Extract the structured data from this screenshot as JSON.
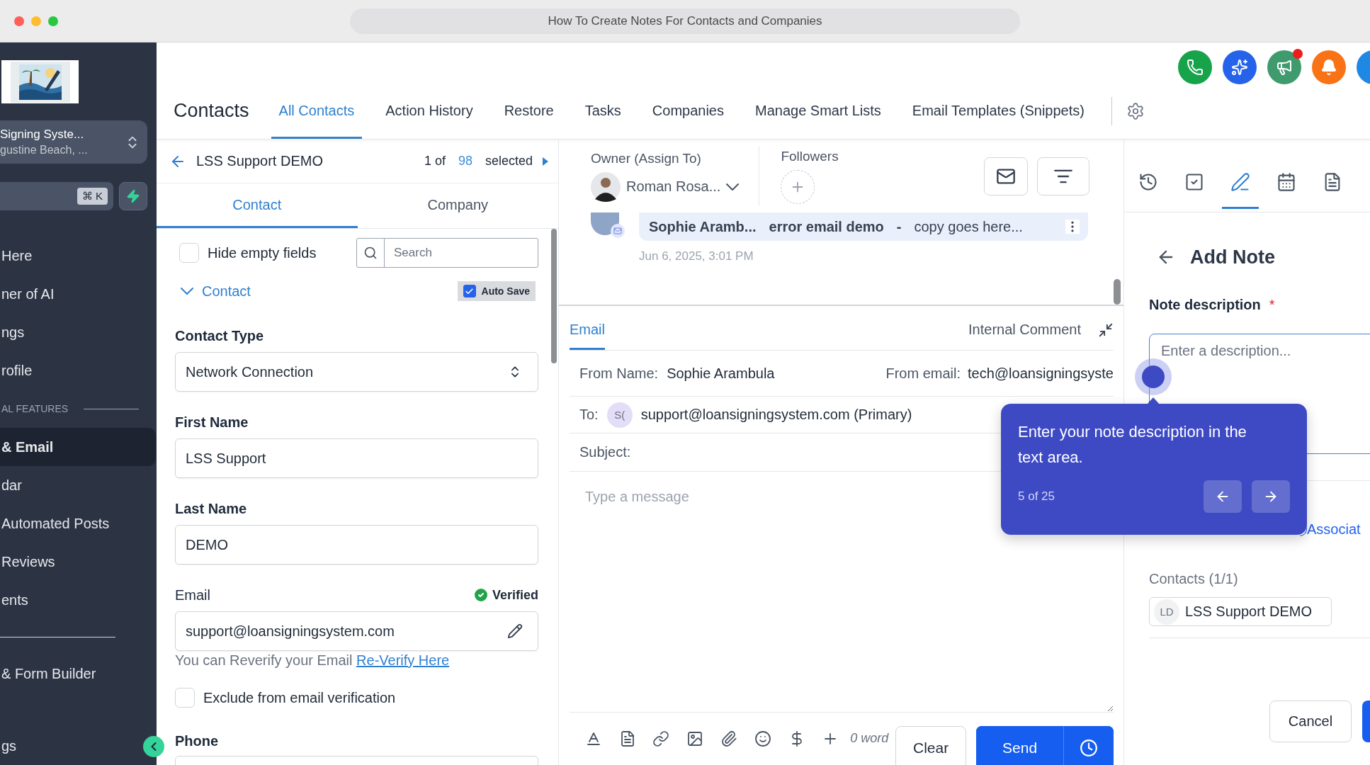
{
  "window": {
    "title": "How To Create Notes For Contacts and Companies"
  },
  "sidebar": {
    "location": {
      "name": "Signing Syste...",
      "address": "gustine Beach, ..."
    },
    "shortcut": "⌘ K",
    "items": [
      {
        "kind": "link",
        "label": "Here",
        "selected": false
      },
      {
        "kind": "link",
        "label": "ner of AI",
        "selected": false
      },
      {
        "kind": "link",
        "label": "ngs",
        "selected": false
      },
      {
        "kind": "link",
        "label": "rofile",
        "selected": false
      },
      {
        "kind": "heading",
        "label": "AL FEATURES"
      },
      {
        "kind": "link",
        "label": "& Email",
        "selected": true
      },
      {
        "kind": "link",
        "label": "dar",
        "selected": false
      },
      {
        "kind": "link",
        "label": "Automated Posts",
        "selected": false
      },
      {
        "kind": "link",
        "label": "Reviews",
        "selected": false
      },
      {
        "kind": "link",
        "label": "ents",
        "selected": false
      },
      {
        "kind": "divider"
      },
      {
        "kind": "link",
        "label": "& Form Builder",
        "selected": false
      },
      {
        "kind": "link",
        "label": "gs",
        "selected": false
      }
    ]
  },
  "header": {
    "title": "Contacts",
    "actions": [
      {
        "kind": "phone",
        "color": "#16a34a",
        "notification": false
      },
      {
        "kind": "sparkle",
        "color": "#2563eb",
        "notification": false
      },
      {
        "kind": "megaphone",
        "color": "#3f9a6e",
        "notification": true
      },
      {
        "kind": "bell",
        "color": "#f97316",
        "notification": false
      },
      {
        "kind": "blank",
        "color": "#1e88e5"
      }
    ],
    "tabs": [
      {
        "label": "All Contacts",
        "selected": true
      },
      {
        "label": "Action History",
        "selected": false
      },
      {
        "label": "Restore",
        "selected": false
      },
      {
        "label": "Tasks",
        "selected": false
      },
      {
        "label": "Companies",
        "selected": false
      },
      {
        "label": "Manage Smart Lists",
        "selected": false
      },
      {
        "label": "Email Templates (Snippets)",
        "selected": false
      }
    ]
  },
  "record": {
    "name": "LSS Support DEMO",
    "counter_prefix": "1 of",
    "count": "98",
    "counter_suffix": "selected"
  },
  "detail_tabs": [
    {
      "label": "Contact",
      "selected": true
    },
    {
      "label": "Company",
      "selected": false
    }
  ],
  "hide_empty": {
    "label": "Hide empty fields",
    "checked": false
  },
  "field_search": {
    "placeholder": "Search"
  },
  "section": {
    "title": "Contact",
    "expanded": true
  },
  "auto_save": {
    "label": "Auto Save",
    "checked": true
  },
  "fields": [
    {
      "kind": "select",
      "label": "Contact Type",
      "value": "Network Connection"
    },
    {
      "kind": "text",
      "label": "First Name",
      "value": "LSS Support"
    },
    {
      "kind": "text",
      "label": "Last Name",
      "value": "DEMO"
    },
    {
      "kind": "email",
      "label": "Email",
      "value": "support@loansigningsystem.com",
      "status": "Verified",
      "hint": "You can Reverify your Email",
      "hint_link": "Re-Verify Here"
    }
  ],
  "exclude_verification": {
    "label": "Exclude from email verification",
    "checked": false
  },
  "phone": {
    "label": "Phone"
  },
  "owner": {
    "label": "Owner (Assign To)",
    "name": "Roman Rosa..."
  },
  "followers": {
    "label": "Followers"
  },
  "message": {
    "sender": "Sophie Aramb...",
    "subject": "error email demo",
    "separator": "-",
    "preview": "copy goes here...",
    "time": "Jun 6, 2025, 3:01 PM"
  },
  "composer": {
    "tabs": [
      {
        "label": "Email",
        "selected": true
      },
      {
        "label": "Internal Comment",
        "selected": false
      }
    ],
    "from_name_label": "From Name:",
    "from_name": "Sophie Arambula",
    "from_email_label": "From email:",
    "from_email": "tech@loansigningsyste",
    "to_label": "To:",
    "to_initials": "S(",
    "to": "support@loansigningsystem.com (Primary)",
    "subject_label": "Subject:",
    "message_placeholder": "Type a message",
    "word_count": "0 word",
    "clear": "Clear",
    "send": "Send"
  },
  "note_tabs": [
    {
      "kind": "history",
      "selected": false
    },
    {
      "kind": "task",
      "selected": false
    },
    {
      "kind": "note",
      "selected": true
    },
    {
      "kind": "calendar",
      "selected": false
    },
    {
      "kind": "document",
      "selected": false
    }
  ],
  "add_note": {
    "title": "Add Note",
    "description_label": "Note description",
    "required_mark": "*",
    "placeholder": "Enter a description...",
    "associate_link": "Associat",
    "contacts_heading": "Contacts (1/1)",
    "contact_initials": "LD",
    "contact_name": "LSS Support DEMO",
    "cancel": "Cancel"
  },
  "tour": {
    "text": "Enter your note description in the text area.",
    "step": "5 of 25"
  }
}
